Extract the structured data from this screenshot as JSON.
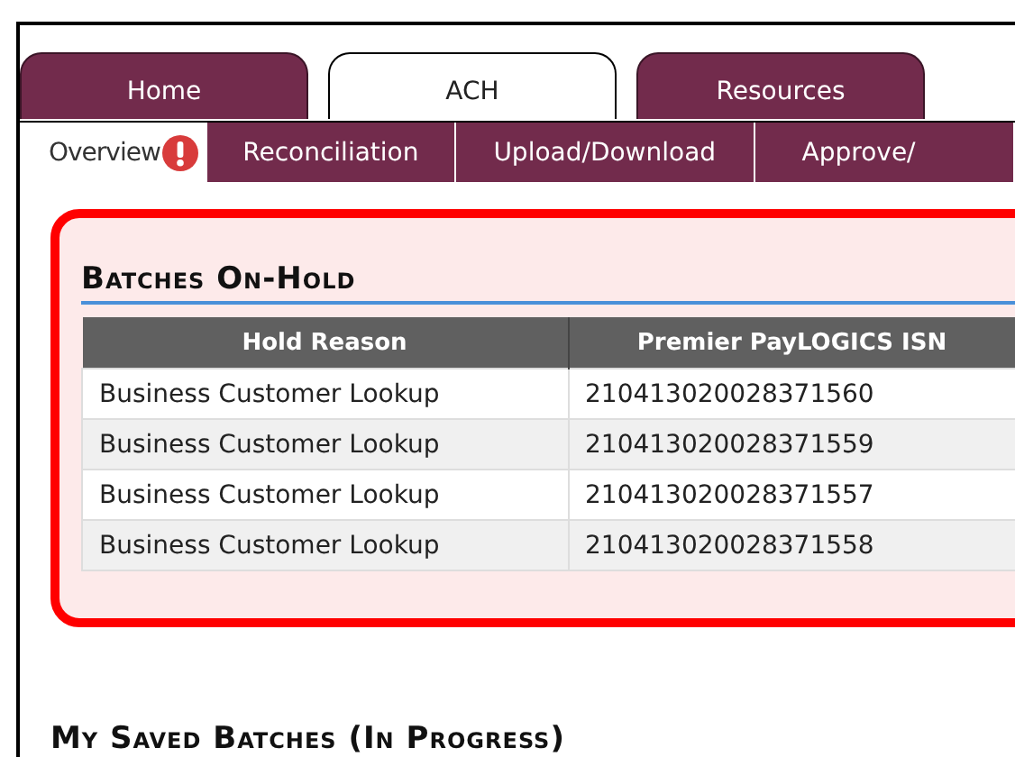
{
  "tabs": [
    {
      "label": "Home",
      "selected": false
    },
    {
      "label": "ACH",
      "selected": true
    },
    {
      "label": "Resources",
      "selected": false
    }
  ],
  "subtabs": [
    {
      "label": "Overview",
      "selected": true,
      "alert": true
    },
    {
      "label": "Reconciliation",
      "selected": false,
      "alert": false
    },
    {
      "label": "Upload/Download",
      "selected": false,
      "alert": false
    },
    {
      "label": "Approve/",
      "selected": false,
      "alert": false
    }
  ],
  "on_hold": {
    "title": "Batches On-Hold",
    "columns": [
      "Hold Reason",
      "Premier PayLOGICS ISN"
    ],
    "rows": [
      [
        "Business Customer Lookup",
        "210413020028371560"
      ],
      [
        "Business Customer Lookup",
        "210413020028371559"
      ],
      [
        "Business Customer Lookup",
        "210413020028371557"
      ],
      [
        "Business Customer Lookup",
        "210413020028371558"
      ]
    ]
  },
  "saved": {
    "title": "My Saved Batches (In Progress)"
  }
}
